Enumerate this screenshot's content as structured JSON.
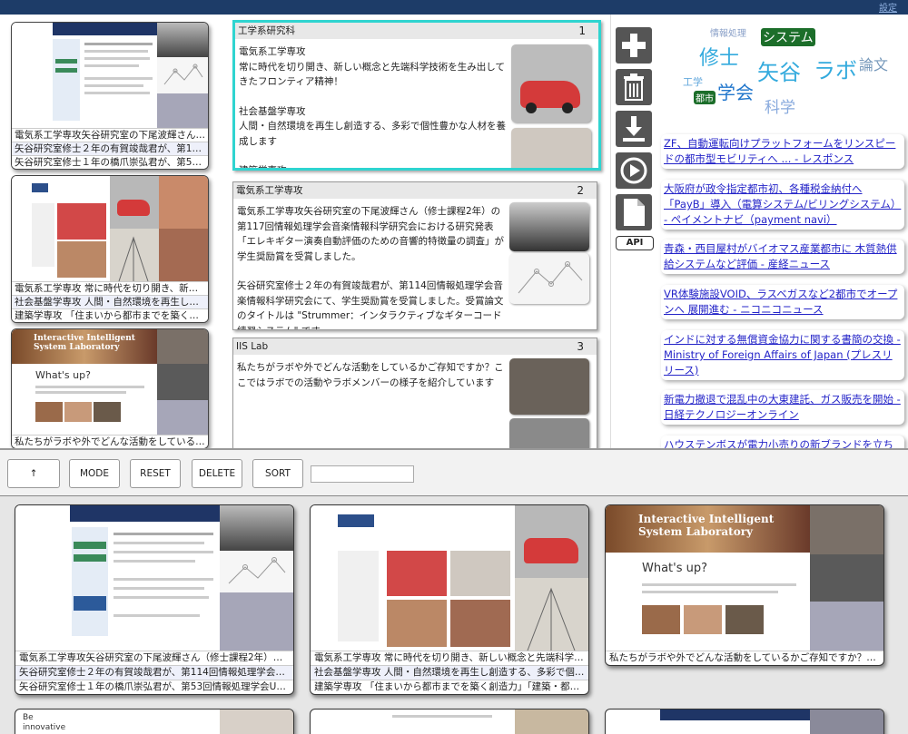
{
  "colors": {
    "accent": "#2fd4d0",
    "topbar": "#1d3c68",
    "link": "#2424c8"
  },
  "header": {
    "corner_link": "設定"
  },
  "left_cards": [
    {
      "captions": [
        "電気系工学専攻矢谷研究室の下尾波輝さん…",
        "矢谷研究室修士２年の有賀竣哉君が、第11…",
        "矢谷研究室修士１年の橋爪崇弘君が、第53…"
      ]
    },
    {
      "captions": [
        "電気系工学専攻 常に時代を切り開き、新…",
        "社会基盤学専攻 人間・自然環境を再生し…",
        "建築学専攻 「住まいから都市までを築く…"
      ]
    },
    {
      "title": "Interactive Intelligent System Laboratory",
      "whats_up": "What's up?",
      "captions": [
        "私たちがラボや外でどんな活動をしている…"
      ]
    }
  ],
  "docs": [
    {
      "title": "工学系研究科",
      "num": "1",
      "paragraphs": [
        "電気系工学専攻\n常に時代を切り開き、新しい概念と先端科学技術を生み出してきたフロンティア精神！",
        "社会基盤学専攻\n人間・自然環境を再生し創造する、多彩で個性豊かな人材を養成します",
        "建築学専攻\n「住まいから都市までを築く創造力」「建築・都市の設計を行う"
      ]
    },
    {
      "title": "電気系工学専攻",
      "num": "2",
      "paragraphs": [
        "電気系工学専攻矢谷研究室の下尾波輝さん（修士課程2年）の第117回情報処理学会音楽情報科学研究会における研究発表「エレキギター演奏自動評価のための音響的特徴量の調査」が学生奨励賞を受賞しました。",
        "矢谷研究室修士２年の有賀竣哉君が、第114回情報処理学会音楽情報科学研究会にて、学生奨励賞を受賞しました。受賞論文のタイトルは \"Strummer：インタラクティブなギターコード練習システム\" です。"
      ]
    },
    {
      "title": "IIS Lab",
      "num": "3",
      "paragraphs": [
        "私たちがラボや外でどんな活動をしているかご存知ですか？ここではラボでの活動やラボメンバーの様子を紹介しています"
      ]
    }
  ],
  "tools": {
    "api": "API",
    "icons": [
      "plus-icon",
      "trash-icon",
      "download-icon",
      "play-icon",
      "document-icon"
    ]
  },
  "cloud": [
    {
      "t": "情報処理",
      "c": "#8aa0c8",
      "s": 10
    },
    {
      "t": "システム",
      "c": "#ffffff",
      "bg": "#1c6e2a",
      "s": 14
    },
    {
      "t": "修士",
      "c": "#33aadd",
      "s": 22
    },
    {
      "t": "矢谷",
      "c": "#33aadd",
      "s": 24
    },
    {
      "t": "ラボ",
      "c": "#33aadd",
      "s": 24
    },
    {
      "t": "論文",
      "c": "#7799bb",
      "s": 16
    },
    {
      "t": "工学",
      "c": "#66aadd",
      "s": 11
    },
    {
      "t": "都市",
      "c": "#ffffff",
      "bg": "#1c6e2a",
      "s": 10
    },
    {
      "t": "学会",
      "c": "#2277cc",
      "s": 20
    },
    {
      "t": "科学",
      "c": "#88aadd",
      "s": 17
    }
  ],
  "news": [
    "ZF、自動運転向けプラットフォームをリンスピードの都市型モビリティへ ... - レスポンス",
    "大阪府が政令指定都市初、各種税金納付へ「PayB」導入（電算システム/ビリングシステム） - ペイメントナビ（payment navi）",
    "青森・西目屋村がバイオマス産業都市に 木質熱供給システムなど評価 - 産経ニュース",
    "VR体験施設VOID、ラスベガスなど2都市でオープンへ 展開進む - ニコニコニュース",
    "インドに対する無償資金協力に関する書簡の交換 - Ministry of Foreign Affairs of Japan (プレスリリース)",
    "新電力撤退で混乱中の大東建託、ガス販売を開始 - 日経テクノロジーオンライン",
    "ハウステンボスが電力小売りの新ブランドを立ち上げ"
  ],
  "controls": {
    "up": "↑",
    "mode": "MODE",
    "reset": "RESET",
    "delete": "DELETE",
    "sort": "SORT",
    "search_value": ""
  },
  "bottom_cards": [
    {
      "captions": [
        "電気系工学専攻矢谷研究室の下尾波輝さん（修士課程2年）の…",
        "矢谷研究室修士２年の有賀竣哉君が、第114回情報処理学会音楽…",
        "矢谷研究室修士１年の橋爪崇弘君が、第53回情報処理学会UBI…"
      ]
    },
    {
      "captions": [
        "電気系工学専攻 常に時代を切り開き、新しい概念と先端科学…",
        "社会基盤学専攻 人間・自然環境を再生し創造する、多彩で個…",
        "建築学専攻 「住まいから都市までを築く創造力」「建築・都…"
      ]
    },
    {
      "title": "Interactive Intelligent System Laboratory",
      "whats_up": "What's up?",
      "captions": [
        "私たちがラボや外でどんな活動をしているかご存知ですか？こ…"
      ]
    }
  ],
  "partial_cards": {
    "first": "Be innovative"
  }
}
